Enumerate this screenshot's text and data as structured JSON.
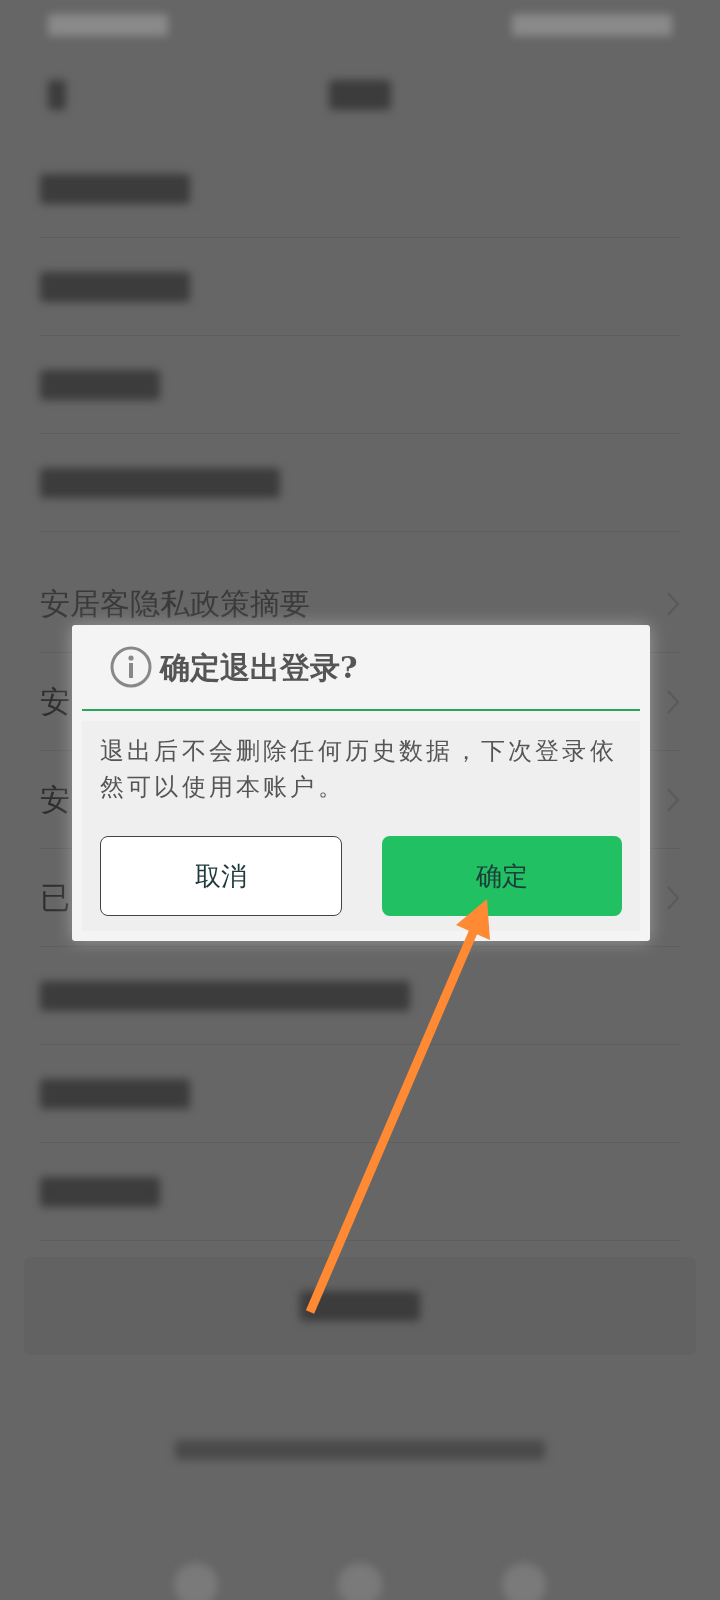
{
  "rows": [
    {
      "kind": "blurred"
    },
    {
      "kind": "blurred"
    },
    {
      "kind": "blurred"
    },
    {
      "kind": "blurred"
    },
    {
      "kind": "gap"
    },
    {
      "kind": "text",
      "label": "安居客隐私政策摘要",
      "chevron": true
    },
    {
      "kind": "text",
      "label": "安",
      "chevron": true
    },
    {
      "kind": "text",
      "label": "安",
      "chevron": true
    },
    {
      "kind": "text",
      "label": "已",
      "chevron": true
    },
    {
      "kind": "blurred"
    },
    {
      "kind": "blurred"
    },
    {
      "kind": "blurred"
    }
  ],
  "dialog": {
    "title": "确定退出登录?",
    "message": "退出后不会删除任何历史数据，下次登录依然可以使用本账户。",
    "buttons": [
      {
        "label": "取消",
        "kind": "outline"
      },
      {
        "label": "确定",
        "kind": "primary"
      }
    ]
  }
}
